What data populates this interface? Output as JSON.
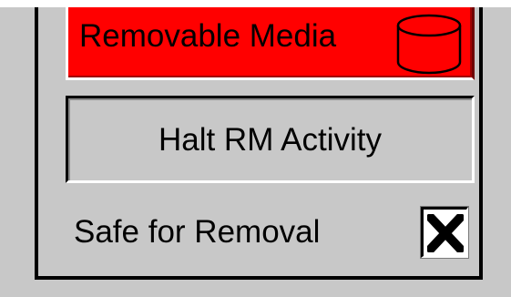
{
  "media": {
    "label": "Removable Media",
    "icon": "database-icon",
    "color": "#ff0000"
  },
  "halt": {
    "label": "Halt RM Activity"
  },
  "safe": {
    "label": "Safe for Removal",
    "checked": true,
    "icon": "x-mark-icon"
  }
}
